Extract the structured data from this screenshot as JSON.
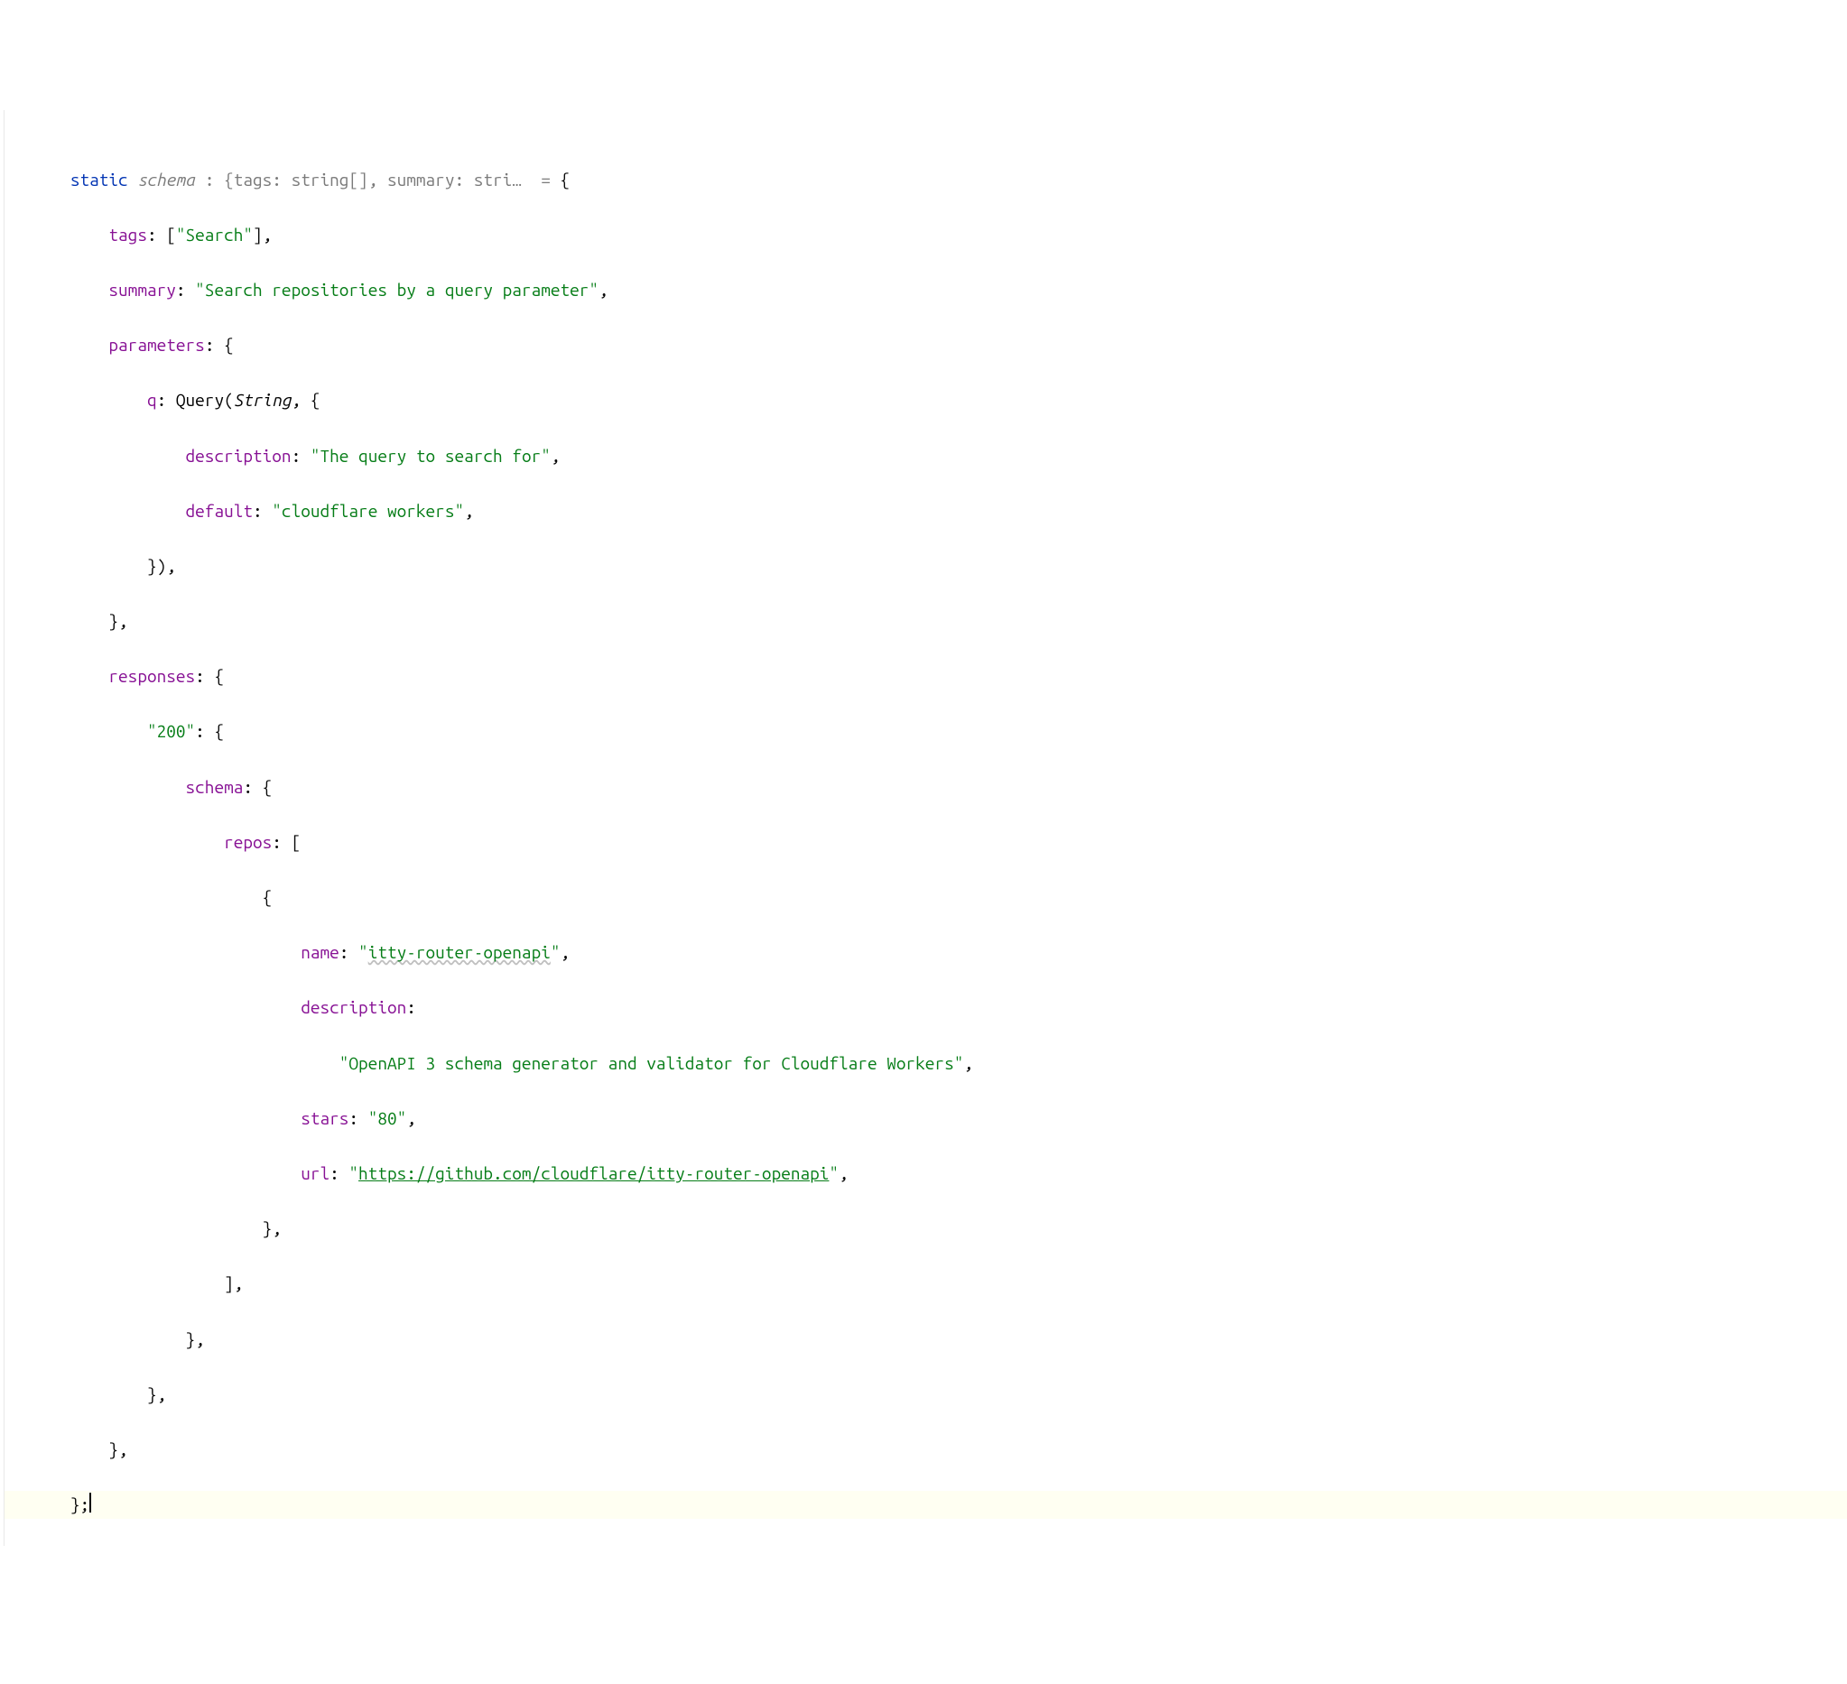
{
  "code": {
    "kw_static": "static",
    "var_schema": "schema",
    "hint_prefix": " : ",
    "hint_type": "{tags: string[], summary: stri…",
    "hint_equals": "  = ",
    "brace_open": "{",
    "key_tags": "tags",
    "tags_value": ": [",
    "tags_str": "\"Search\"",
    "tags_close": "],",
    "key_summary": "summary",
    "summary_colon": ": ",
    "summary_str": "\"Search repositories by a query parameter\"",
    "comma": ",",
    "key_parameters": "parameters",
    "parameters_open": ": {",
    "key_q": "q",
    "q_colon": ": ",
    "q_func": "Query",
    "q_paren_open": "(",
    "q_string": "String",
    "q_sep": ", {",
    "key_description": "description",
    "desc_colon": ": ",
    "desc_str": "\"The query to search for\"",
    "key_default": "default",
    "default_colon": ": ",
    "default_str": "\"cloudflare workers\"",
    "query_close": "}),",
    "params_close": "},",
    "key_responses": "responses",
    "responses_open": ": {",
    "key_200": "\"200\"",
    "k200_open": ": {",
    "key_schema2": "schema",
    "schema2_open": ": {",
    "key_repos": "repos",
    "repos_open": ": [",
    "obj_open": "{",
    "key_name": "name",
    "name_colon": ": ",
    "name_str_q": "\"",
    "name_str_txt": "itty-router-openapi",
    "name_str_q2": "\"",
    "key_desc2": "description",
    "desc2_colon": ":",
    "desc2_str": "\"OpenAPI 3 schema generator and validator for Cloudflare Workers\"",
    "key_stars": "stars",
    "stars_colon": ": ",
    "stars_str": "\"80\"",
    "key_url": "url",
    "url_colon": ": ",
    "url_q": "\"",
    "url_str": "https://github.com/cloudflare/itty-router-openapi",
    "url_q2": "\"",
    "obj_close": "},",
    "repos_close": "],",
    "schema2_close": "},",
    "k200_close": "},",
    "responses_close": "},",
    "final_close": "};"
  }
}
